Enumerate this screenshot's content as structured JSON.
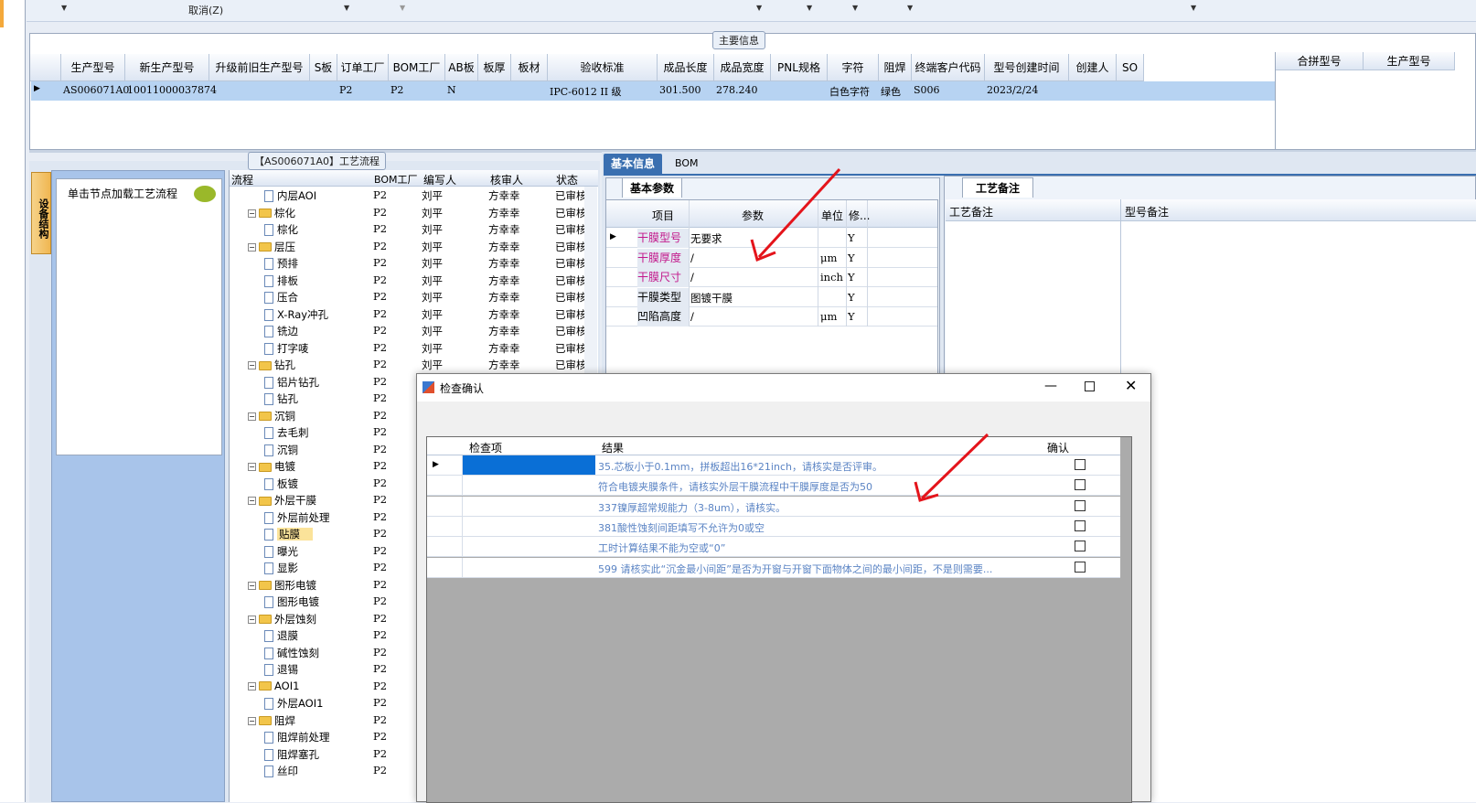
{
  "toolbar": {
    "cancel": "取消(Z)"
  },
  "main_info": {
    "title": "主要信息",
    "columns": [
      "生产型号",
      "新生产型号",
      "升级前旧生产型号",
      "S板",
      "订单工厂",
      "BOM工厂",
      "AB板",
      "板厚",
      "板材",
      "验收标准",
      "成品长度",
      "成品宽度",
      "PNL规格",
      "字符",
      "阻焊",
      "终端客户代码",
      "型号创建时间",
      "创建人",
      "SO"
    ],
    "row": {
      "生产型号": "AS006071A0",
      "新生产型号": "10011000037874",
      "订单工厂": "P2",
      "BOM工厂": "P2",
      "AB板": "N",
      "验收标准": "IPC-6012 II 级",
      "成品长度": "301.500",
      "成品宽度": "278.240",
      "字符": "白色字符",
      "阻焊": "绿色",
      "终端客户代码": "S006",
      "型号创建时间": "2023/2/24"
    },
    "right_columns": [
      "合拼型号",
      "生产型号"
    ]
  },
  "process": {
    "title": "【AS006071A0】工艺流程",
    "side_tab": "设备结构",
    "load_hint": "单击节点加载工艺流程",
    "headers": [
      "流程",
      "BOM工厂",
      "编写人",
      "核审人",
      "状态"
    ],
    "rows": [
      {
        "level": 2,
        "type": "doc",
        "name": "内层AOI",
        "bom": "P2",
        "writer": "刘平",
        "reviewer": "方幸幸",
        "status": "已审核"
      },
      {
        "level": 1,
        "type": "folder",
        "name": "棕化",
        "bom": "P2",
        "writer": "刘平",
        "reviewer": "方幸幸",
        "status": "已审核"
      },
      {
        "level": 2,
        "type": "doc",
        "name": "棕化",
        "bom": "P2",
        "writer": "刘平",
        "reviewer": "方幸幸",
        "status": "已审核"
      },
      {
        "level": 1,
        "type": "folder",
        "name": "层压",
        "bom": "P2",
        "writer": "刘平",
        "reviewer": "方幸幸",
        "status": "已审核"
      },
      {
        "level": 2,
        "type": "doc",
        "name": "预排",
        "bom": "P2",
        "writer": "刘平",
        "reviewer": "方幸幸",
        "status": "已审核"
      },
      {
        "level": 2,
        "type": "doc",
        "name": "排板",
        "bom": "P2",
        "writer": "刘平",
        "reviewer": "方幸幸",
        "status": "已审核"
      },
      {
        "level": 2,
        "type": "doc",
        "name": "压合",
        "bom": "P2",
        "writer": "刘平",
        "reviewer": "方幸幸",
        "status": "已审核"
      },
      {
        "level": 2,
        "type": "doc",
        "name": "X-Ray冲孔",
        "bom": "P2",
        "writer": "刘平",
        "reviewer": "方幸幸",
        "status": "已审核"
      },
      {
        "level": 2,
        "type": "doc",
        "name": "铣边",
        "bom": "P2",
        "writer": "刘平",
        "reviewer": "方幸幸",
        "status": "已审核"
      },
      {
        "level": 2,
        "type": "doc",
        "name": "打字唛",
        "bom": "P2",
        "writer": "刘平",
        "reviewer": "方幸幸",
        "status": "已审核"
      },
      {
        "level": 1,
        "type": "folder",
        "name": "钻孔",
        "bom": "P2",
        "writer": "刘平",
        "reviewer": "方幸幸",
        "status": "已审核"
      },
      {
        "level": 2,
        "type": "doc",
        "name": "铝片钻孔",
        "bom": "P2",
        "writer": "",
        "reviewer": "",
        "status": ""
      },
      {
        "level": 2,
        "type": "doc",
        "name": "钻孔",
        "bom": "P2",
        "writer": "",
        "reviewer": "",
        "status": ""
      },
      {
        "level": 1,
        "type": "folder",
        "name": "沉铜",
        "bom": "P2",
        "writer": "",
        "reviewer": "",
        "status": ""
      },
      {
        "level": 2,
        "type": "doc",
        "name": "去毛刺",
        "bom": "P2",
        "writer": "",
        "reviewer": "",
        "status": ""
      },
      {
        "level": 2,
        "type": "doc",
        "name": "沉铜",
        "bom": "P2",
        "writer": "",
        "reviewer": "",
        "status": ""
      },
      {
        "level": 1,
        "type": "folder",
        "name": "电镀",
        "bom": "P2",
        "writer": "",
        "reviewer": "",
        "status": ""
      },
      {
        "level": 2,
        "type": "doc",
        "name": "板镀",
        "bom": "P2",
        "writer": "",
        "reviewer": "",
        "status": ""
      },
      {
        "level": 1,
        "type": "folder",
        "name": "外层干膜",
        "bom": "P2",
        "writer": "",
        "reviewer": "",
        "status": ""
      },
      {
        "level": 2,
        "type": "doc",
        "name": "外层前处理",
        "bom": "P2",
        "writer": "",
        "reviewer": "",
        "status": ""
      },
      {
        "level": 2,
        "type": "doc",
        "name": "贴膜",
        "bom": "P2",
        "writer": "",
        "reviewer": "",
        "status": "",
        "selected": true
      },
      {
        "level": 2,
        "type": "doc",
        "name": "曝光",
        "bom": "P2",
        "writer": "",
        "reviewer": "",
        "status": ""
      },
      {
        "level": 2,
        "type": "doc",
        "name": "显影",
        "bom": "P2",
        "writer": "",
        "reviewer": "",
        "status": ""
      },
      {
        "level": 1,
        "type": "folder",
        "name": "图形电镀",
        "bom": "P2",
        "writer": "",
        "reviewer": "",
        "status": ""
      },
      {
        "level": 2,
        "type": "doc",
        "name": "图形电镀",
        "bom": "P2",
        "writer": "",
        "reviewer": "",
        "status": ""
      },
      {
        "level": 1,
        "type": "folder",
        "name": "外层蚀刻",
        "bom": "P2",
        "writer": "",
        "reviewer": "",
        "status": ""
      },
      {
        "level": 2,
        "type": "doc",
        "name": "退膜",
        "bom": "P2",
        "writer": "",
        "reviewer": "",
        "status": ""
      },
      {
        "level": 2,
        "type": "doc",
        "name": "碱性蚀刻",
        "bom": "P2",
        "writer": "",
        "reviewer": "",
        "status": ""
      },
      {
        "level": 2,
        "type": "doc",
        "name": "退锡",
        "bom": "P2",
        "writer": "",
        "reviewer": "",
        "status": ""
      },
      {
        "level": 1,
        "type": "folder",
        "name": "AOI1",
        "bom": "P2",
        "writer": "",
        "reviewer": "",
        "status": ""
      },
      {
        "level": 2,
        "type": "doc",
        "name": "外层AOI1",
        "bom": "P2",
        "writer": "",
        "reviewer": "",
        "status": ""
      },
      {
        "level": 1,
        "type": "folder",
        "name": "阻焊",
        "bom": "P2",
        "writer": "",
        "reviewer": "",
        "status": ""
      },
      {
        "level": 2,
        "type": "doc",
        "name": "阻焊前处理",
        "bom": "P2",
        "writer": "",
        "reviewer": "",
        "status": ""
      },
      {
        "level": 2,
        "type": "doc",
        "name": "阻焊塞孔",
        "bom": "P2",
        "writer": "",
        "reviewer": "",
        "status": ""
      },
      {
        "level": 2,
        "type": "doc",
        "name": "丝印",
        "bom": "P2",
        "writer": "",
        "reviewer": "",
        "status": ""
      }
    ]
  },
  "tabs": {
    "basic_info": "基本信息",
    "bom": "BOM",
    "basic_params": "基本参数",
    "process_notes": "工艺备注"
  },
  "params": {
    "headers": [
      "项目",
      "参数",
      "单位",
      "修..."
    ],
    "rows": [
      {
        "item": "干膜型号",
        "value": "无要求",
        "unit": "",
        "mod": "Y"
      },
      {
        "item": "干膜厚度",
        "value": "/",
        "unit": "μm",
        "mod": "Y"
      },
      {
        "item": "干膜尺寸",
        "value": "/",
        "unit": "inch",
        "mod": "Y"
      },
      {
        "item": "干膜类型",
        "value": "图镀干膜",
        "unit": "",
        "mod": "Y"
      },
      {
        "item": "凹陷高度",
        "value": "/",
        "unit": "μm",
        "mod": "Y"
      }
    ]
  },
  "notes": {
    "headers": [
      "工艺备注",
      "型号备注"
    ]
  },
  "dialog": {
    "title": "检查确认",
    "headers": [
      "检查项",
      "结果",
      "确认"
    ],
    "rows": [
      {
        "result": "35.芯板小于0.1mm，拼板超出16*21inch，请核实是否评审。"
      },
      {
        "result": "符合电镀夹膜条件，请核实外层干膜流程中干膜厚度是否为50"
      },
      {
        "result": "337镍厚超常规能力（3-8um），请核实。"
      },
      {
        "result": "381酸性蚀刻间距填写不允许为0或空"
      },
      {
        "result": "工时计算结果不能为空或“0”"
      },
      {
        "result": "599 请核实此“沉金最小间距”是否为开窗与开窗下面物体之间的最小间距，不是则需要..."
      }
    ]
  },
  "colors": {
    "accent": "#3a6fb0",
    "selected_row": "#b7d3f2",
    "tree_selected": "#fbe39a",
    "param_item": "#c2188b",
    "result_text": "#5b84c4",
    "arrow": "#e4141b"
  }
}
